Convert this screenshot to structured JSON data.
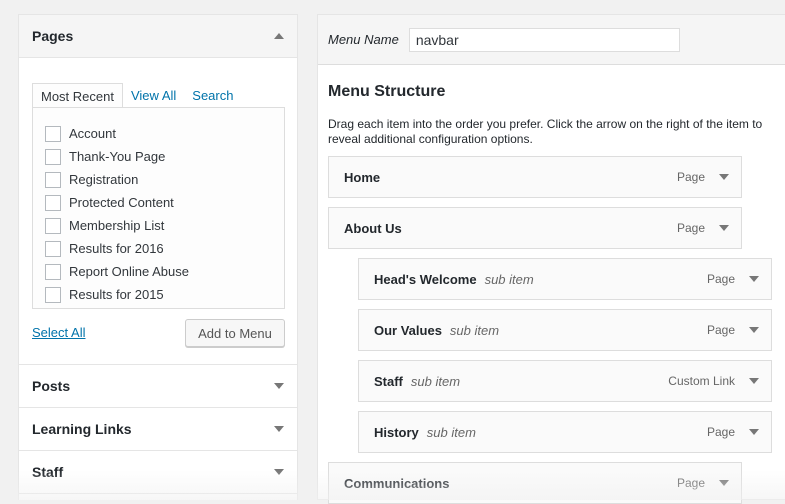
{
  "left": {
    "pages_title": "Pages",
    "tabs": [
      "Most Recent",
      "View All",
      "Search"
    ],
    "pages": [
      "Account",
      "Thank-You Page",
      "Registration",
      "Protected Content",
      "Membership List",
      "Results for 2016",
      "Report Online Abuse",
      "Results for 2015"
    ],
    "select_all": "Select All",
    "add_button": "Add to Menu",
    "sections": [
      "Posts",
      "Learning Links",
      "Staff"
    ]
  },
  "right": {
    "menu_name_label": "Menu Name",
    "menu_name_value": "navbar",
    "heading": "Menu Structure",
    "description": "Drag each item into the order you prefer. Click the arrow on the right of the item to reveal additional configuration options.",
    "items": [
      {
        "title": "Home",
        "sub": "",
        "type": "Page"
      },
      {
        "title": "About Us",
        "sub": "",
        "type": "Page"
      },
      {
        "title": "Head's Welcome",
        "sub": "sub item",
        "type": "Page"
      },
      {
        "title": "Our Values",
        "sub": "sub item",
        "type": "Page"
      },
      {
        "title": "Staff",
        "sub": "sub item",
        "type": "Custom Link"
      },
      {
        "title": "History",
        "sub": "sub item",
        "type": "Page"
      },
      {
        "title": "Communications",
        "sub": "",
        "type": "Page"
      }
    ]
  }
}
